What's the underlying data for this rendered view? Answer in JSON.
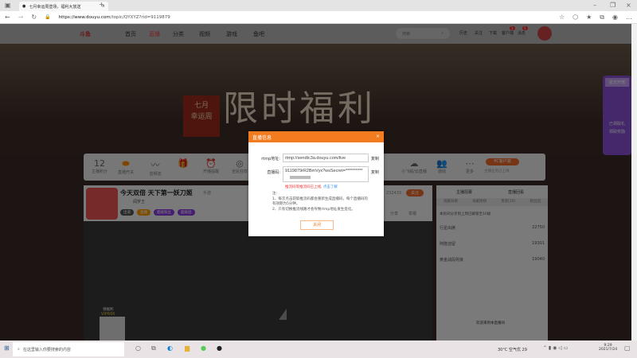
{
  "browser": {
    "tab_title": "七月幸运周登场，福利大放送",
    "url_host": "https://www.douyu.com",
    "url_path": "/topic/QYXYZ?rid=9119879"
  },
  "site": {
    "logo": "斗鱼",
    "nav": [
      "首页",
      "直播",
      "分类",
      "视频",
      "游戏",
      "鱼吧"
    ],
    "search_placeholder": "搜索",
    "user_icons": [
      "历史",
      "关注",
      "下载",
      "客户端",
      "消息"
    ],
    "msg_badge": "1",
    "notif_badge": "5"
  },
  "banner": {
    "seal_line1": "七月",
    "seal_line2": "幸运周",
    "title": "限时福利"
  },
  "toolbar": {
    "count": "12",
    "count_label": "主播积分",
    "items": [
      "直播开关",
      "音频流",
      "",
      "开播提醒",
      "全民狂欢",
      "",
      "",
      "",
      "",
      "",
      "小飞船/云直播",
      "游戏",
      "更多"
    ],
    "pc_button": "PC客户端",
    "pc_note": "主播业务已上线"
  },
  "stream": {
    "title": "今天双倍 天下第一妖刀姬",
    "category": "手游",
    "tags": [
      "出道",
      "直播",
      "超级粉丝",
      "超级团"
    ],
    "streamer": "阎罗王",
    "follow": "关注",
    "followers": "232433",
    "share": "分享",
    "report": "举报"
  },
  "right_panel": {
    "links": [
      "主播招募",
      "直播回看"
    ],
    "tabs": [
      "贡献日榜",
      "贡献周榜",
      "贵宾(10)",
      "粉丝团"
    ],
    "notice": "本房间分享到上周已解锁至10级",
    "ranks": [
      {
        "name": "行星出席",
        "score": "22750"
      },
      {
        "name": "阿隆迪留",
        "score": "19301"
      },
      {
        "name": "黄金战段则良",
        "score": "19040"
      }
    ],
    "chat": "欢迎来到本直播间"
  },
  "float_panel": {
    "title": "星光开宠",
    "line1": "已领取礼",
    "line2": "领取奖励"
  },
  "video": {
    "vip": "VIP666",
    "qr_label": "领福利"
  },
  "dialog": {
    "title": "直播信息",
    "rtmp_label": "rtmp地址:",
    "rtmp_value": "rtmp://sendtc3a.douyu.com/live",
    "code_label": "直播码:",
    "code_value": "9119879rR2BmVyx?wsSecret=**********",
    "copy": "复制",
    "warn": "推流码等推流码已上线,",
    "learn_more": "点击了解",
    "note_title": "注:",
    "note1": "1、每次点击获取推流码都会重新生成直播码，每个直播码的有效期为5分钟。",
    "note2": "2、只有切换推流线路才会导致rtmp地址发生变化。",
    "close": "关闭"
  },
  "taskbar": {
    "search_placeholder": "在这里输入你要搜索的内容",
    "weather": "30°C 空气优 29",
    "time": "9:29",
    "date": "2021/7/24"
  }
}
